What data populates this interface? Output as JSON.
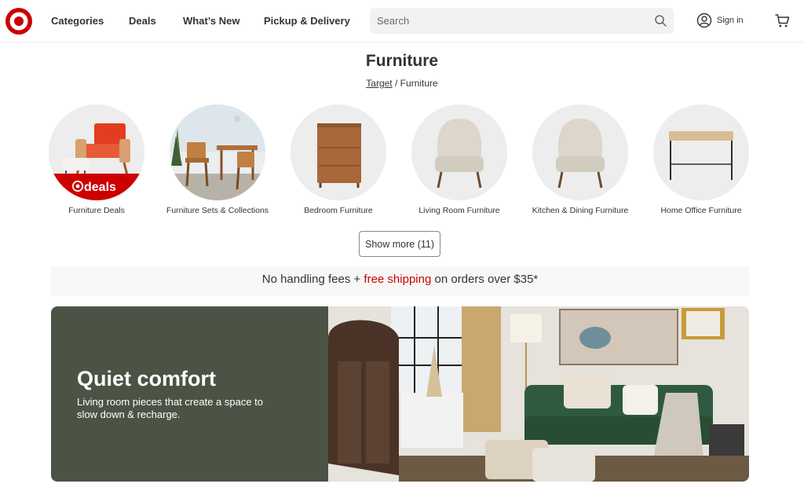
{
  "header": {
    "nav": [
      {
        "label": "Categories"
      },
      {
        "label": "Deals"
      },
      {
        "label": "What’s New"
      },
      {
        "label": "Pickup & Delivery"
      }
    ],
    "search": {
      "placeholder": "Search",
      "value": ""
    },
    "sign_in_label": "Sign in",
    "brand_color": "#cc0000"
  },
  "page": {
    "title": "Furniture",
    "breadcrumb": {
      "root": "Target",
      "separator": "/",
      "current": "Furniture"
    }
  },
  "categories": [
    {
      "label": "Furniture Deals",
      "badge": "deals"
    },
    {
      "label": "Furniture Sets & Collections"
    },
    {
      "label": "Bedroom Furniture"
    },
    {
      "label": "Living Room Furniture"
    },
    {
      "label": "Kitchen & Dining Furniture"
    },
    {
      "label": "Home Office Furniture"
    }
  ],
  "show_more_label": "Show more (11)",
  "promo": {
    "before": "No handling fees + ",
    "highlight": "free shipping",
    "after": " on orders over $35*"
  },
  "banner": {
    "title": "Quiet comfort",
    "subtitle": "Living room pieces that create a space to slow down & recharge.",
    "panel_color": "#4b5444"
  }
}
